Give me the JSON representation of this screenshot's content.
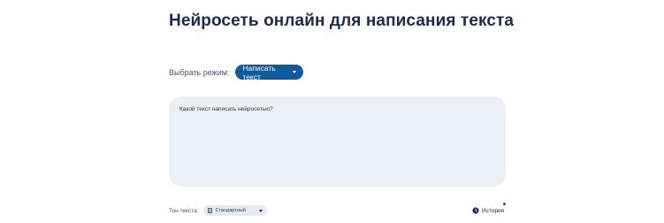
{
  "page": {
    "title": "Нейросеть онлайн для написания текста"
  },
  "mode": {
    "label": "Выбрать режим:",
    "selected": "Написать текст",
    "icon": "chevron-down-icon"
  },
  "prompt": {
    "placeholder": "Какой текст написать нейросетью?",
    "value": ""
  },
  "tone": {
    "label": "Тон текста:",
    "selected": "Стандартный",
    "icon": "document-icon"
  },
  "history": {
    "label": "История",
    "icon": "clock-icon",
    "badge_color": "#c0162c"
  },
  "colors": {
    "accent": "#0f5a9a",
    "title": "#1b2a52",
    "input_bg": "#ebeff6"
  }
}
